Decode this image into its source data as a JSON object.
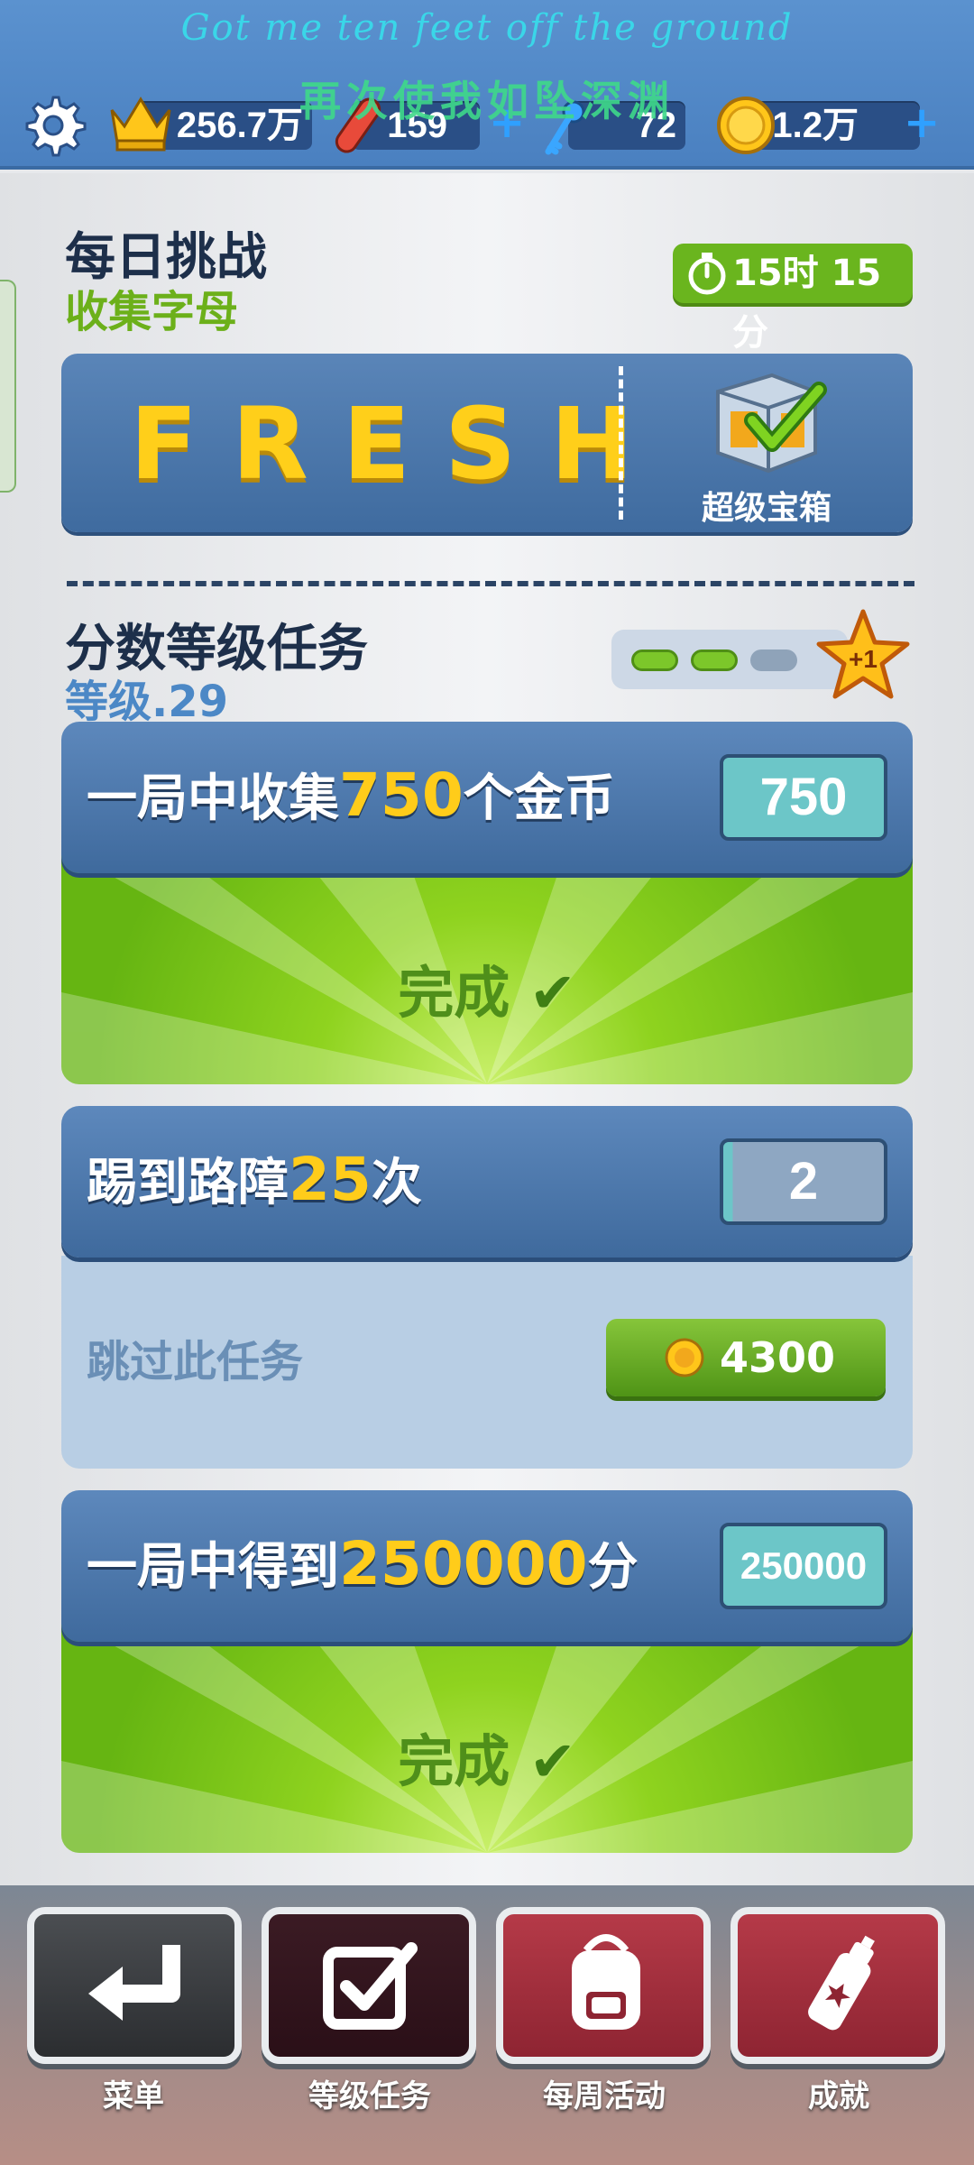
{
  "overlay": {
    "lyric_line1": "Got me ten feet off the ground",
    "lyric_line2": "再次使我如坠深渊"
  },
  "currencies": {
    "score": "256.7万",
    "hoverboards": "159",
    "keys": "72",
    "coins": "1.2万"
  },
  "daily": {
    "title": "每日挑战",
    "subtitle": "收集字母",
    "timer": "15时 15分",
    "word": "FRESH",
    "chest_label": "超级宝箱"
  },
  "missions": {
    "title": "分数等级任务",
    "level_label": "等级.29",
    "progress_filled": 2,
    "progress_total": 3,
    "star_label": "+1",
    "tasks": [
      {
        "title_prefix": "一局中收集",
        "title_num": "750",
        "title_suffix": "个金币",
        "count": "750",
        "status": "完成"
      },
      {
        "title_prefix": "踢到路障",
        "title_num": "25",
        "title_suffix": "次",
        "count": "2",
        "skip_label": "跳过此任务",
        "skip_cost": "4300"
      },
      {
        "title_prefix": "一局中得到",
        "title_num": "250000",
        "title_suffix": "分",
        "count": "250000",
        "status": "完成"
      }
    ]
  },
  "nav": {
    "menu": "菜单",
    "missions": "等级任务",
    "weekly": "每周活动",
    "achievements": "成就"
  },
  "colors": {
    "accent_green": "#6ab51e",
    "header_blue": "#4a80c0",
    "coin_yellow": "#ffcc1a"
  }
}
